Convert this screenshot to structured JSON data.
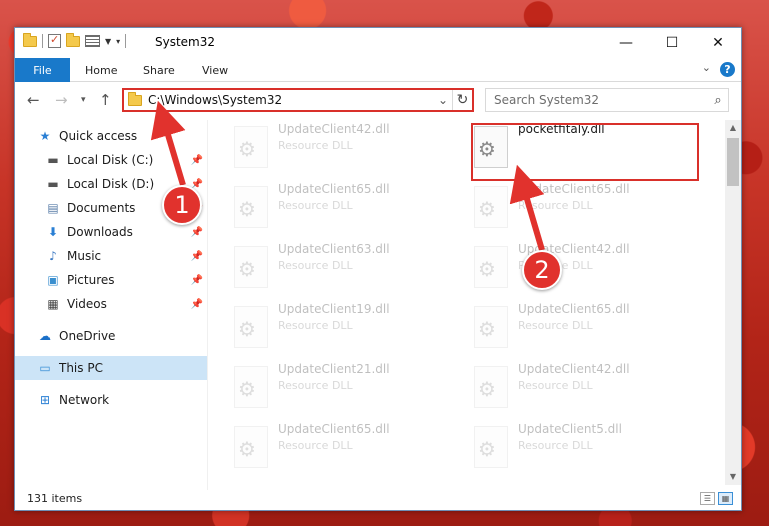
{
  "window": {
    "title": "System32",
    "controls": {
      "minimize": "—",
      "maximize": "☐",
      "close": "✕"
    }
  },
  "ribbon": {
    "tabs": [
      {
        "label": "File"
      },
      {
        "label": "Home"
      },
      {
        "label": "Share"
      },
      {
        "label": "View"
      }
    ],
    "help": "?"
  },
  "nav": {
    "address": "C:\\Windows\\System32",
    "search_placeholder": "Search System32"
  },
  "sidebar": {
    "items": [
      {
        "label": "Quick access",
        "icon": "star-icon"
      },
      {
        "label": "Local Disk (C:)",
        "icon": "drive-icon"
      },
      {
        "label": "Local Disk (D:)",
        "icon": "drive-icon"
      },
      {
        "label": "Documents",
        "icon": "documents-icon"
      },
      {
        "label": "Downloads",
        "icon": "download-icon"
      },
      {
        "label": "Music",
        "icon": "music-icon"
      },
      {
        "label": "Pictures",
        "icon": "pictures-icon"
      },
      {
        "label": "Videos",
        "icon": "videos-icon"
      },
      {
        "label": "OneDrive",
        "icon": "cloud-icon"
      },
      {
        "label": "This PC",
        "icon": "computer-icon"
      },
      {
        "label": "Network",
        "icon": "network-icon"
      }
    ]
  },
  "files": {
    "highlighted": {
      "name": "pocketfitaly.dll"
    },
    "left_column": [
      {
        "name": "UpdateClient42.dll",
        "type": "Resource DLL"
      },
      {
        "name": "UpdateClient65.dll",
        "type": "Resource DLL"
      },
      {
        "name": "UpdateClient63.dll",
        "type": "Resource DLL"
      },
      {
        "name": "UpdateClient19.dll",
        "type": "Resource DLL"
      },
      {
        "name": "UpdateClient21.dll",
        "type": "Resource DLL"
      },
      {
        "name": "UpdateClient65.dll",
        "type": "Resource DLL"
      }
    ],
    "right_column": [
      {
        "name": "UpdateClient65.dll",
        "type": "Resource DLL"
      },
      {
        "name": "UpdateClient42.dll",
        "type": "Resource DLL"
      },
      {
        "name": "UpdateClient65.dll",
        "type": "Resource DLL"
      },
      {
        "name": "UpdateClient42.dll",
        "type": "Resource DLL"
      },
      {
        "name": "UpdateClient5.dll",
        "type": "Resource DLL"
      }
    ]
  },
  "status": {
    "item_count": "131 items"
  },
  "annotations": {
    "step1": "1",
    "step2": "2",
    "color": "#e1322d"
  }
}
